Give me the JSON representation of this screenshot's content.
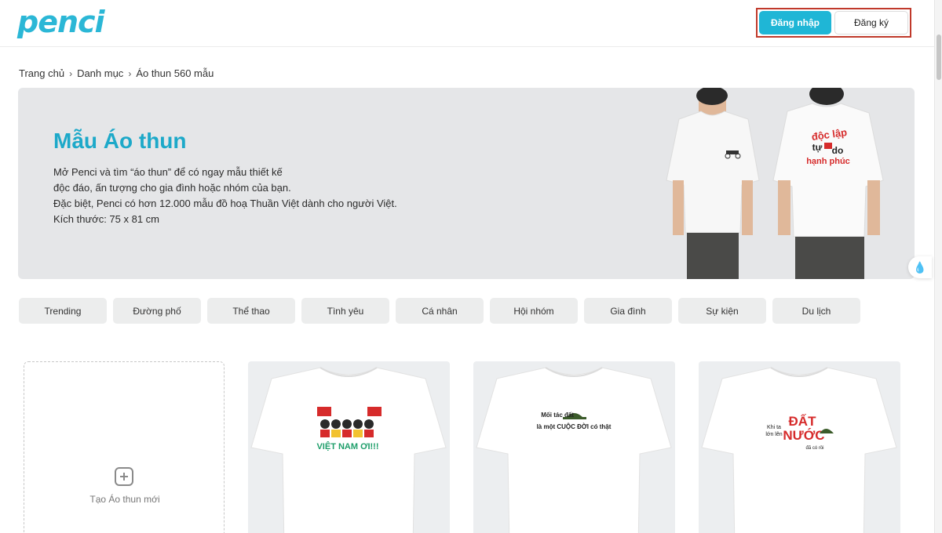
{
  "header": {
    "logo_text": "penci",
    "login_label": "Đăng nhập",
    "register_label": "Đăng ký"
  },
  "breadcrumb": {
    "items": [
      "Trang chủ",
      "Danh mục",
      "Áo thun 560 mẫu"
    ]
  },
  "banner": {
    "title": "Mẫu Áo thun",
    "lines": [
      "Mở Penci và tìm “áo thun” để có ngay mẫu thiết kế",
      "độc đáo, ấn tượng cho gia đình hoặc nhóm của bạn.",
      "Đặc biệt, Penci có hơn 12.000 mẫu đồ hoạ Thuần Việt dành cho người Việt.",
      "Kích thước: 75 x 81 cm"
    ],
    "back_print_text": [
      "độc lập",
      "tự",
      "do",
      "hạnh phúc"
    ]
  },
  "categories": [
    "Trending",
    "Đường phố",
    "Thể thao",
    "Tình yêu",
    "Cá nhân",
    "Hội nhóm",
    "Gia đình",
    "Sự kiện",
    "Du lịch"
  ],
  "create_card": {
    "label": "Tạo Áo thun mới"
  },
  "products": [
    {
      "print_text": "VIỆT NAM ƠI!!!"
    },
    {
      "print_text": [
        "Mối tác đất",
        "là một CUỘC ĐỜI có thật"
      ]
    },
    {
      "print_text": [
        "Khi ta",
        "lớn lên",
        "ĐẤT",
        "NƯỚC",
        "đã có rồi"
      ]
    }
  ],
  "colors": {
    "brand": "#2bb7d6",
    "login_button": "#1fb6d6",
    "highlight_border": "#c0392b",
    "banner_bg": "#e5e6e8"
  }
}
